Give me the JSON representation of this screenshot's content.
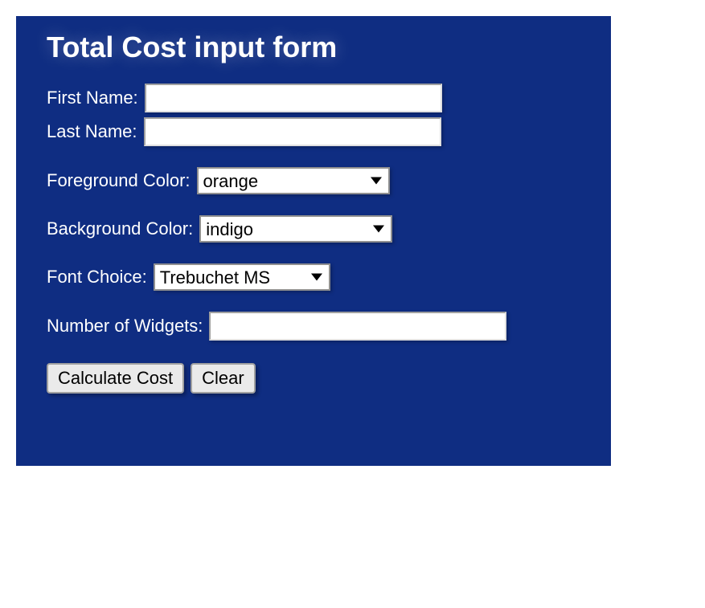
{
  "form": {
    "title": "Total Cost input form",
    "fields": {
      "first_name": {
        "label": "First Name:",
        "value": ""
      },
      "last_name": {
        "label": "Last Name:",
        "value": ""
      },
      "fg_color": {
        "label": "Foreground Color:",
        "selected": "orange"
      },
      "bg_color": {
        "label": "Background Color:",
        "selected": "indigo"
      },
      "font_choice": {
        "label": "Font Choice:",
        "selected": "Trebuchet MS"
      },
      "num_widgets": {
        "label": "Number of Widgets:",
        "value": ""
      }
    },
    "buttons": {
      "calculate": "Calculate Cost",
      "clear": "Clear"
    }
  },
  "colors": {
    "panel_bg": "#0f2d82",
    "panel_fg": "#ffffff"
  }
}
